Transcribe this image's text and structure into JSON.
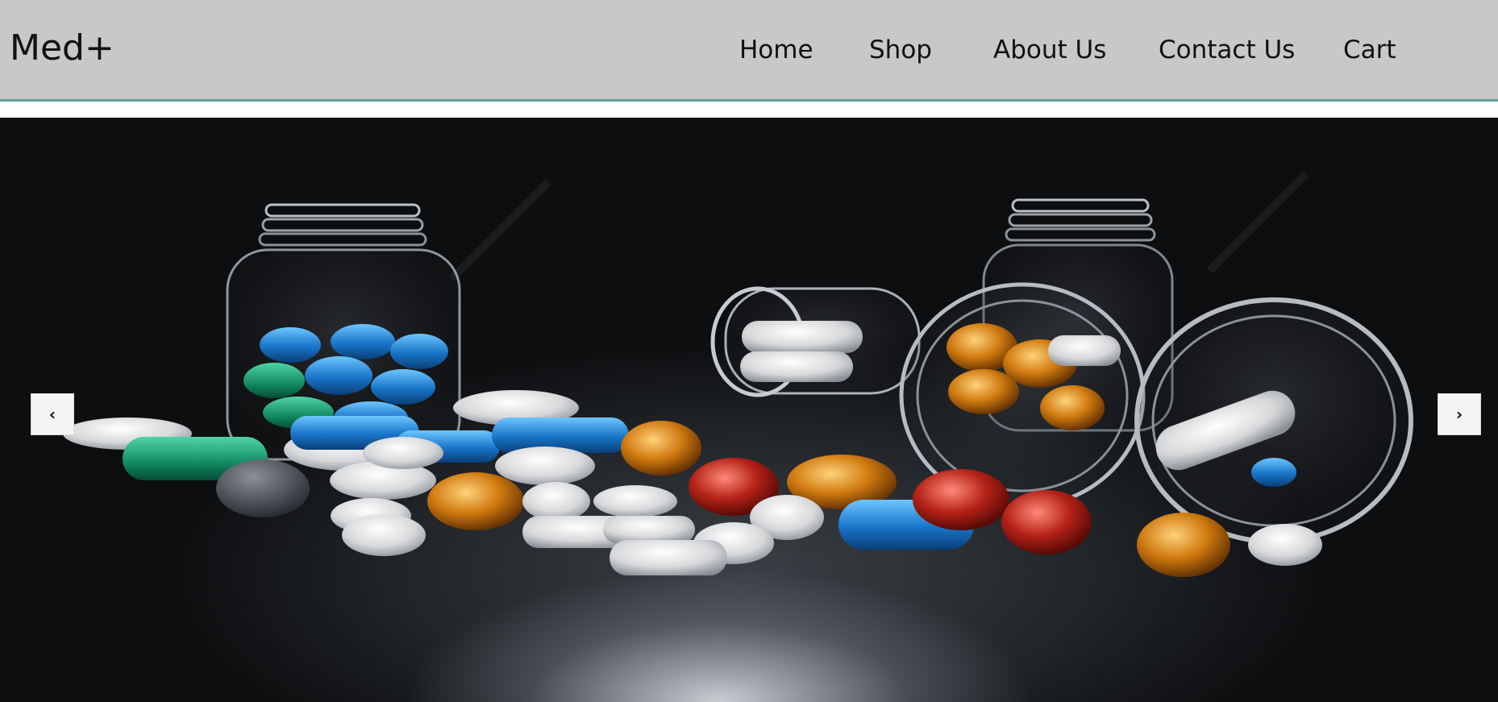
{
  "brand": {
    "name": "Med+"
  },
  "nav": {
    "items": [
      {
        "label": "Home"
      },
      {
        "label": "Shop"
      },
      {
        "label": "About Us"
      },
      {
        "label": "Contact Us"
      },
      {
        "label": "Cart"
      }
    ]
  },
  "carousel": {
    "prev_label": "‹",
    "next_label": "›",
    "slide_image": "medicine-pills-bottles"
  },
  "colors": {
    "navbar_bg": "#c8c8c8",
    "navbar_border": "#5f9ea0",
    "hero_bg": "#0b0c0e"
  }
}
